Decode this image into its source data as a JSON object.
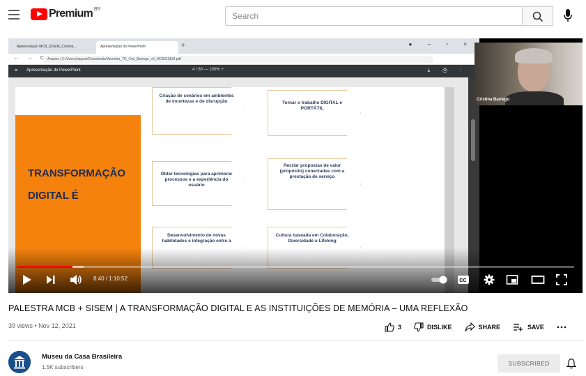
{
  "header": {
    "logo_text": "Premium",
    "logo_sup": "BR",
    "search_placeholder": "Search"
  },
  "player": {
    "browser": {
      "tab1": "Apresentação MCB_SISEM_Cristina...",
      "tab2": "Apresentação do PowerPoint",
      "url": "Arquivo | C:/Users/paquet/Downloads/Memória_TD_Cris_Barrego_v6_MCBSISEM.pdf",
      "pdf_title": "Apresentação do PowerPoint",
      "pdf_zoom": "4 / 60   —  100%  +"
    },
    "slide": {
      "title_line1": "TRANSFORMAÇÃO",
      "title_line2": "DIGITAL É",
      "boxes": [
        "Criação de cenários em ambientes de incertezas e de disrupção",
        "Tornar o trabalho DIGITAL e PORTÁTIL",
        "Obter tecnologias para aprimorar processos e a experiência do usuário",
        "Recriar propostas de valor (propósito) conectadas com a prestação de serviço",
        "Desenvolvimento de novas habilidades e integração entre a",
        "Cultura baseada em Colaboração, Diversidade e Lifelong"
      ]
    },
    "camera_name": "Cristina Barrego",
    "time": "8:40 / 1:10:52",
    "progress_fraction": 0.1
  },
  "video": {
    "title": "PALESTRA MCB + SISEM | A TRANSFORMAÇÃO DIGITAL E AS INSTITUIÇÕES DE MEMÓRIA – UMA REFLEXÃO",
    "meta": "39 views • Nov 12, 2021",
    "likes": "3",
    "dislike_label": "DISLIKE",
    "share_label": "SHARE",
    "save_label": "SAVE"
  },
  "channel": {
    "name": "Museu da Casa Brasileira",
    "subscribers": "1.5K subscribers",
    "subscribe_label": "SUBSCRIBED"
  },
  "colors": {
    "brand_red": "#ff0000",
    "slide_orange": "#f5820d",
    "slide_navy": "#1f2d4d"
  }
}
